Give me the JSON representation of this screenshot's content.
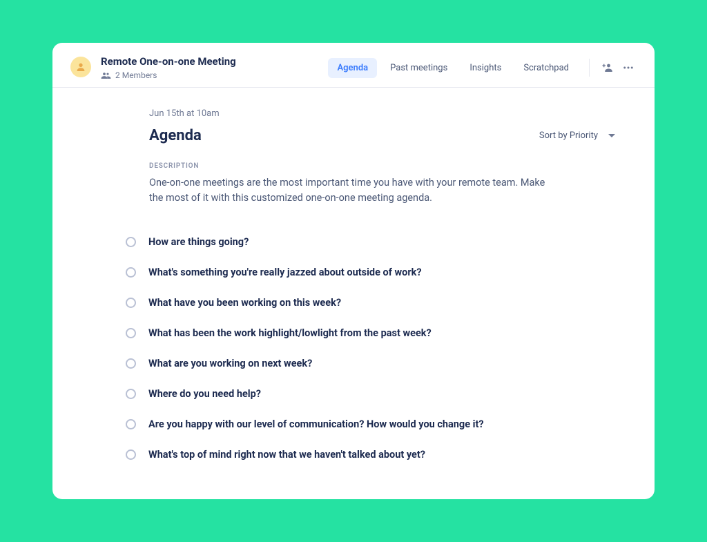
{
  "header": {
    "title": "Remote One-on-one Meeting",
    "members_label": "2 Members",
    "tabs": [
      {
        "label": "Agenda",
        "active": true
      },
      {
        "label": "Past meetings",
        "active": false
      },
      {
        "label": "Insights",
        "active": false
      },
      {
        "label": "Scratchpad",
        "active": false
      }
    ]
  },
  "content": {
    "date": "Jun 15th at 10am",
    "heading": "Agenda",
    "sort_label": "Sort by Priority",
    "description_label": "DESCRIPTION",
    "description_body": "One-on-one meetings are the most important time you have with your remote team. Make the most of it with this customized one-on-one meeting agenda.",
    "items": [
      "How are things going?",
      "What's something you're really jazzed about outside of work?",
      "What have you been working on this week?",
      "What has been the work highlight/lowlight from the past week?",
      "What are you working on next week?",
      "Where do you need help?",
      "Are you happy with our level of communication? How would you change it?",
      "What's top of mind right now that we haven't talked about yet?"
    ]
  }
}
